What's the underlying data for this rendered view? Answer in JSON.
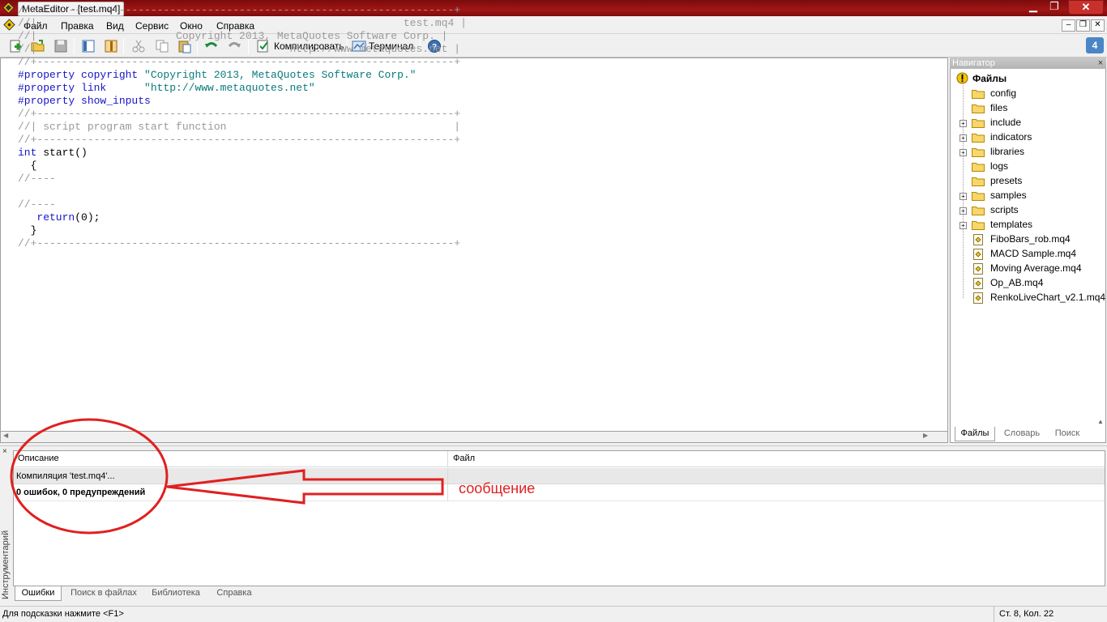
{
  "window": {
    "title": "MetaEditor - [test.mq4]",
    "controls": {
      "minimize": "▁",
      "maximize": "❐",
      "close": "✕"
    }
  },
  "menu": {
    "items": [
      "Файл",
      "Правка",
      "Вид",
      "Сервис",
      "Окно",
      "Справка"
    ],
    "mdi": {
      "minimize": "–",
      "restore": "❐",
      "close": "✕"
    }
  },
  "toolbar": {
    "compile_label": "Компилировать",
    "terminal_label": "Терминал",
    "notifications_count": "4"
  },
  "editor": {
    "lines": [
      [
        {
          "t": "//+------------------------------------------------------------------+",
          "c": "cm"
        }
      ],
      [
        {
          "t": "//|                                                          test.mq4 |",
          "c": "cm"
        }
      ],
      [
        {
          "t": "//|                      Copyright 2013, MetaQuotes Software Corp. |",
          "c": "cm"
        }
      ],
      [
        {
          "t": "//|                                        http://www.metaquotes.net |",
          "c": "cm"
        }
      ],
      [
        {
          "t": "//+------------------------------------------------------------------+",
          "c": "cm"
        }
      ],
      [
        {
          "t": "#property ",
          "c": "pl"
        },
        {
          "t": "copyright ",
          "c": "pl"
        },
        {
          "t": "\"Copyright 2013, MetaQuotes Software Corp.\"",
          "c": "str"
        }
      ],
      [
        {
          "t": "#property ",
          "c": "pl"
        },
        {
          "t": "link      ",
          "c": "pl"
        },
        {
          "t": "\"http://www.metaquotes.net\"",
          "c": "str"
        }
      ],
      [
        {
          "t": "#property ",
          "c": "pl"
        },
        {
          "t": "show_inputs",
          "c": "pl"
        }
      ],
      [
        {
          "t": "//+------------------------------------------------------------------+",
          "c": "cm"
        }
      ],
      [
        {
          "t": "//| script program start function                                    |",
          "c": "cm"
        }
      ],
      [
        {
          "t": "//+------------------------------------------------------------------+",
          "c": "cm"
        }
      ],
      [
        {
          "t": "int ",
          "c": "kw"
        },
        {
          "t": "start()",
          "c": ""
        }
      ],
      [
        {
          "t": "  {",
          "c": ""
        }
      ],
      [
        {
          "t": "//----",
          "c": "cm"
        }
      ],
      [
        {
          "t": "",
          "c": ""
        }
      ],
      [
        {
          "t": "//----",
          "c": "cm"
        }
      ],
      [
        {
          "t": "   ",
          "c": ""
        },
        {
          "t": "return",
          "c": "kw"
        },
        {
          "t": "(0);",
          "c": ""
        }
      ],
      [
        {
          "t": "  }",
          "c": ""
        }
      ],
      [
        {
          "t": "//+------------------------------------------------------------------+",
          "c": "cm"
        }
      ]
    ]
  },
  "navigator": {
    "title": "Навигатор",
    "close": "×",
    "root": "Файлы",
    "items": [
      {
        "name": "config",
        "type": "folder",
        "expandable": false
      },
      {
        "name": "files",
        "type": "folder",
        "expandable": false
      },
      {
        "name": "include",
        "type": "folder",
        "expandable": true
      },
      {
        "name": "indicators",
        "type": "folder",
        "expandable": true
      },
      {
        "name": "libraries",
        "type": "folder",
        "expandable": true
      },
      {
        "name": "logs",
        "type": "folder",
        "expandable": false
      },
      {
        "name": "presets",
        "type": "folder",
        "expandable": false
      },
      {
        "name": "samples",
        "type": "folder",
        "expandable": true
      },
      {
        "name": "scripts",
        "type": "folder",
        "expandable": true
      },
      {
        "name": "templates",
        "type": "folder",
        "expandable": true
      },
      {
        "name": "FiboBars_rob.mq4",
        "type": "file",
        "expandable": false
      },
      {
        "name": "MACD Sample.mq4",
        "type": "file",
        "expandable": false
      },
      {
        "name": "Moving Average.mq4",
        "type": "file",
        "expandable": false
      },
      {
        "name": "Op_AB.mq4",
        "type": "file",
        "expandable": false
      },
      {
        "name": "RenkoLiveChart_v2.1.mq4",
        "type": "file",
        "expandable": false
      }
    ],
    "tabs": [
      "Файлы",
      "Словарь",
      "Поиск"
    ]
  },
  "toolbox": {
    "side_label": "Инструментарий",
    "close": "×",
    "columns": [
      "Описание",
      "Файл"
    ],
    "rows": [
      "Компиляция 'test.mq4'...",
      "0 ошибок, 0 предупреждений"
    ],
    "tabs": [
      "Ошибки",
      "Поиск в файлах",
      "Библиотека",
      "Справка"
    ]
  },
  "annotation": {
    "label": "сообщение",
    "color": "#e02020"
  },
  "status": {
    "hint": "Для подсказки нажмите <F1>",
    "position": "Ст. 8, Кол. 22"
  }
}
